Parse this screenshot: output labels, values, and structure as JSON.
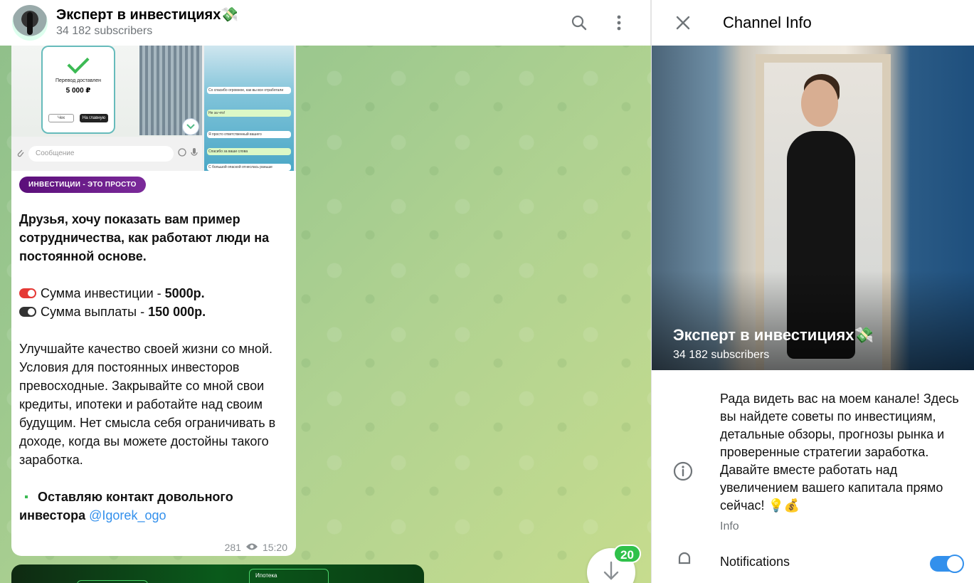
{
  "chat": {
    "title": "Эксперт в инвестициях💸",
    "subscribers": "34 182 subscribers",
    "header_icons": [
      "search-icon",
      "more-vertical-icon"
    ]
  },
  "post": {
    "media": {
      "receipt_title": "Перевод доставлен",
      "receipt_amount": "5 000 ₽",
      "receipt_btn1": "Чек",
      "receipt_btn2": "На главную",
      "input_placeholder": "Сообщение",
      "chat_lines": [
        "Со спасибо огромное, как вы все отработали",
        "Не за что!",
        "Я просто ответственный вашего",
        "Спасибо за ваши слова",
        "С большой опаской отнеслась раньше"
      ]
    },
    "tag": "ИНВЕСТИЦИИ - ЭТО ПРОСТО",
    "intro": "Друзья, хочу показать вам пример сотрудничества, как работают люди на постоянной основе.",
    "invest_label": "Сумма инвестиции - ",
    "invest_value": "5000р.",
    "payout_label": "Сумма выплаты - ",
    "payout_value": "150 000р.",
    "body": "Улучшайте качество своей жизни со мной. Условия для постоянных инвесторов превосходные. Закрывайте со мной свои кредиты, ипотеки и работайте над своим будущим. Нет смысла себя ограничивать в доходе, когда вы можете достойны такого заработка.",
    "contact_label": "Оставляю контакт довольного инвестора ",
    "contact_link": "@Igorek_ogo",
    "views": "281",
    "time": "15:20"
  },
  "post2": {
    "card_label": "Ипотека"
  },
  "scroll": {
    "unread_count": "20"
  },
  "info": {
    "title": "Channel Info",
    "photo_title": "Эксперт в инвестициях💸",
    "photo_sub": "34 182 subscribers",
    "about": "Рада видеть вас на моем канале! Здесь вы найдете советы по инвестициям, детальные обзоры, прогнозы рынка и проверенные стратегии заработка. Давайте вместе работать над увеличением вашего капитала прямо сейчас! 💡💰",
    "about_label": "Info",
    "notifications_label": "Notifications",
    "notifications_on": true
  },
  "colors": {
    "accent": "#3390ec",
    "badge": "#2fc14a",
    "tag_bg": "#5b0f7a"
  }
}
